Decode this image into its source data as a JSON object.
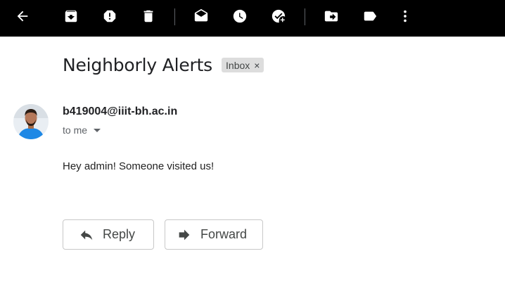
{
  "toolbar": {
    "icons": [
      "back-arrow-icon",
      "archive-icon",
      "report-spam-icon",
      "delete-icon",
      "mark-unread-icon",
      "snooze-icon",
      "add-to-tasks-icon",
      "move-to-icon",
      "label-icon",
      "more-options-icon"
    ],
    "background": "#000000"
  },
  "message": {
    "subject": "Neighborly Alerts",
    "label": "Inbox",
    "label_remove_glyph": "×",
    "sender": "b419004@iiit-bh.ac.in",
    "recipient": "to me",
    "body": "Hey admin! Someone visited us!"
  },
  "actions": {
    "reply_label": "Reply",
    "forward_label": "Forward"
  },
  "colors": {
    "chip_background": "#dddddd",
    "avatar_shirt": "#1e88e5"
  }
}
